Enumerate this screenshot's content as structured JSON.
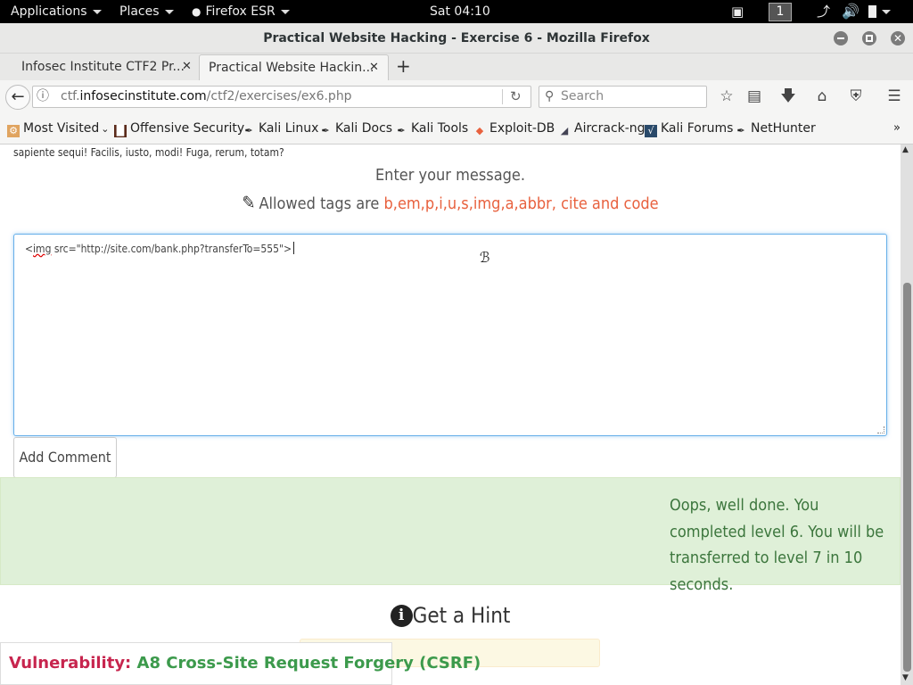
{
  "topbar": {
    "applications": "Applications",
    "places": "Places",
    "browser": "Firefox ESR",
    "clock": "Sat 04:10",
    "workspace": "1"
  },
  "window": {
    "title": "Practical Website Hacking - Exercise 6 - Mozilla Firefox"
  },
  "tabs": [
    {
      "label": "Infosec Institute CTF2 Pr..."
    },
    {
      "label": "Practical Website Hackin..."
    }
  ],
  "navbar": {
    "url_prefix": "ctf.",
    "url_domain": "infosecinstitute.com",
    "url_path": "/ctf2/exercises/ex6.php",
    "search_placeholder": "Search"
  },
  "bookmarks": [
    {
      "label": "Most Visited",
      "icon": "settings-folder-icon"
    },
    {
      "label": "Offensive Security",
      "icon": "offsec-icon"
    },
    {
      "label": "Kali Linux",
      "icon": "kali-dragon-icon"
    },
    {
      "label": "Kali Docs",
      "icon": "kali-dragon-icon"
    },
    {
      "label": "Kali Tools",
      "icon": "kali-dragon-icon"
    },
    {
      "label": "Exploit-DB",
      "icon": "exploit-db-icon"
    },
    {
      "label": "Aircrack-ng",
      "icon": "aircrack-icon"
    },
    {
      "label": "Kali Forums",
      "icon": "kali-forums-icon"
    },
    {
      "label": "NetHunter",
      "icon": "kali-dragon-icon"
    }
  ],
  "page": {
    "lorem_tail": "sapiente sequi! Facilis, iusto, modi! Fuga, rerum, totam?",
    "enter_message": "Enter your message.",
    "allowed_prefix": "Allowed tags are",
    "allowed_tags": "b,em,p,i,u,s,img,a,abbr, cite and code",
    "textarea_value_open": "<",
    "textarea_value_squiggle": "img",
    "textarea_value_rest": " src=\"http://site.com/bank.php?transferTo=555\">",
    "add_comment": "Add Comment",
    "success_message": "Oops, well done. You completed level 6. You will be transferred to level 7 in 10 seconds.",
    "hint_title": "Get a Hint",
    "vuln_label": "Vulnerability:",
    "vuln_value": "A8 Cross-Site Request Forgery (CSRF)"
  },
  "colors": {
    "accent_tags": "#e8613e",
    "success_bg": "#dff0d8",
    "success_text": "#3c763d",
    "vuln_label": "#c7254e",
    "vuln_value": "#3c9a4c"
  }
}
